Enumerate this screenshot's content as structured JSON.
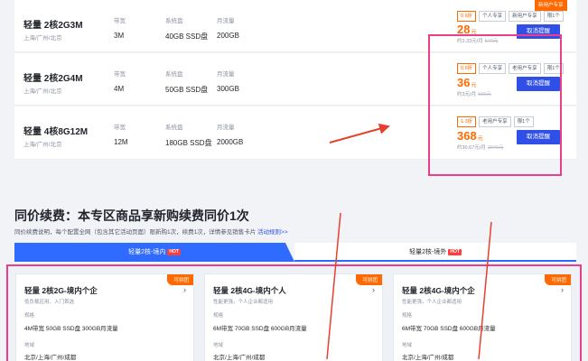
{
  "products": [
    {
      "name": "轻量 2核2G3M",
      "region": "上海/广州/北京",
      "labels": {
        "bandwidth": "带宽",
        "disk": "系统盘",
        "traffic": "月流量"
      },
      "bandwidth": "3M",
      "disk": "40GB SSD盘",
      "traffic": "200GB",
      "tags": [
        "0.6折",
        "个人专享",
        "新用户专享",
        "限1个"
      ],
      "top_tag": "新用户专享",
      "price": "28",
      "unit": "元",
      "price_note": "约2.33元/月",
      "original": "540元",
      "button": "取消提醒"
    },
    {
      "name": "轻量 2核2G4M",
      "region": "上海/广州/北京",
      "labels": {
        "bandwidth": "带宽",
        "disk": "系统盘",
        "traffic": "月流量"
      },
      "bandwidth": "4M",
      "disk": "50GB SSD盘",
      "traffic": "300GB",
      "tags": [
        "0.6折",
        "个人专享",
        "老用户专享",
        "限1个"
      ],
      "price": "36",
      "unit": "元",
      "price_note": "约3元/月",
      "original": "606元",
      "button": "取消提醒"
    },
    {
      "name": "轻量 4核8G12M",
      "region": "上海/广州/北京",
      "labels": {
        "bandwidth": "带宽",
        "disk": "系统盘",
        "traffic": "月流量"
      },
      "bandwidth": "12M",
      "disk": "180GB SSD盘",
      "traffic": "2000GB",
      "tags": [
        "1.3折",
        "老用户专享",
        "限1个"
      ],
      "price": "368",
      "unit": "元",
      "price_note": "约30.67元/月",
      "original": "2946元",
      "button": "取消提醒"
    }
  ],
  "section": {
    "title": "同价续费：本专区商品享新购续费同价1次",
    "desc": "同价续费说明，每个配置全网（包含其它活动页面）限新购1次，续费1次，详情参见销售卡片",
    "rules_link": "活动规则>>"
  },
  "tabs": [
    {
      "label": "轻量2核-境内",
      "hot": "HOT",
      "active": true
    },
    {
      "label": "轻量2核-境外",
      "hot": "HOT",
      "active": false
    }
  ],
  "cards": [
    {
      "title": "轻量 2核2G-境内个企",
      "subtitle": "低负载应用，入门首选",
      "badge": "可拼团",
      "spec_label": "规格",
      "spec": "4M带宽 50GB SSD盘 300GB月流量",
      "region_label": "地域",
      "region": "北京/上海/广州/成都"
    },
    {
      "title": "轻量 2核4G-境内个人",
      "subtitle": "性能更强，个人企业都适用",
      "badge": "可拼团",
      "spec_label": "规格",
      "spec": "6M带宽 70GB SSD盘 600GB月流量",
      "region_label": "地域",
      "region": "北京/上海/广州/成都"
    },
    {
      "title": "轻量 2核4G-境内个企",
      "subtitle": "性能更强，个人企业都适用",
      "badge": "可拼团",
      "spec_label": "规格",
      "spec": "6M带宽 70GB SSD盘 600GB月流量",
      "region_label": "地域",
      "region": "北京/上海/广州/成都"
    }
  ],
  "colors": {
    "accent": "#2f4fe6",
    "price": "#ff6a00",
    "annotation": "#e83e8c",
    "arrow": "#e8402f"
  }
}
